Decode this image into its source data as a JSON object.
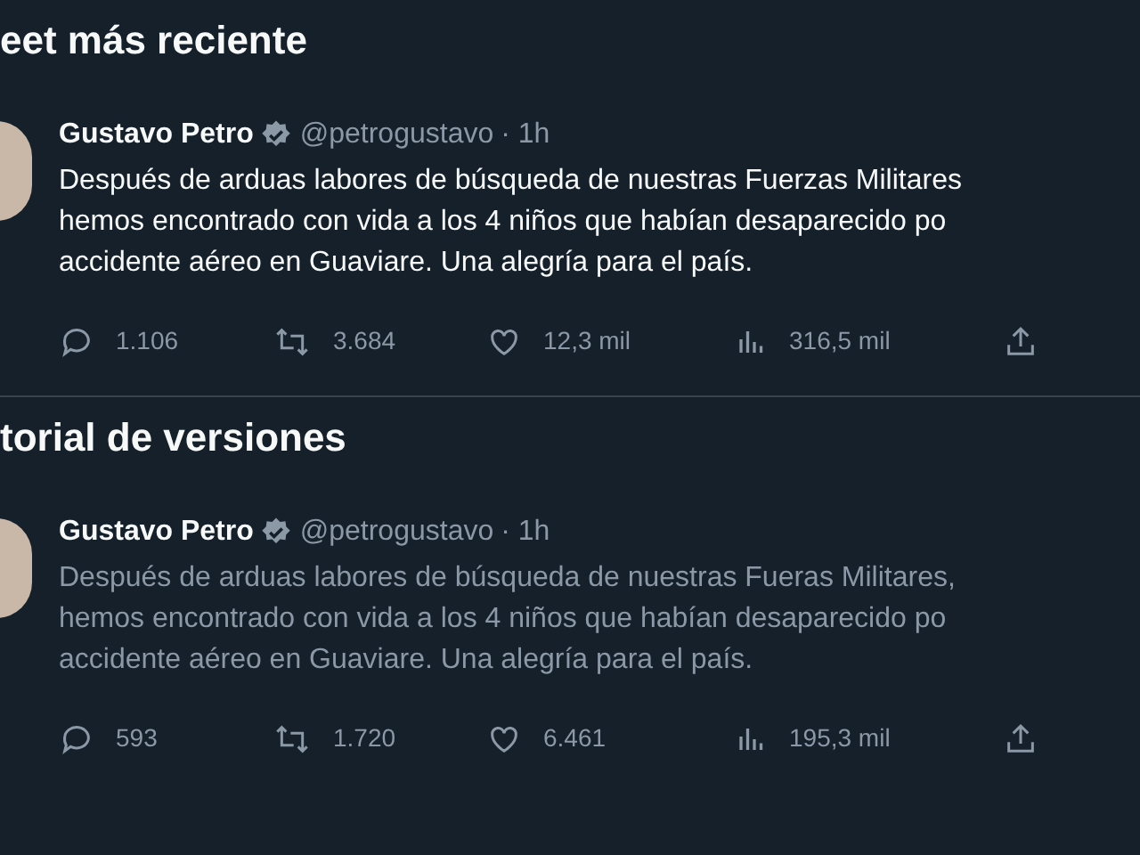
{
  "sections": [
    {
      "heading": "eet más reciente",
      "tweet": {
        "name": "Gustavo Petro",
        "handle": "@petrogustavo",
        "time": "· 1h",
        "faded": false,
        "lines": [
          "Después de arduas labores de búsqueda de nuestras Fuerzas Militares",
          "hemos encontrado con vida a los 4 niños que habían desaparecido po",
          "accidente aéreo en Guaviare. Una alegría para el país."
        ],
        "stats": [
          {
            "kind": "reply",
            "count": "1.106"
          },
          {
            "kind": "retweet",
            "count": "3.684"
          },
          {
            "kind": "like",
            "count": "12,3 mil"
          },
          {
            "kind": "views",
            "count": "316,5 mil"
          },
          {
            "kind": "share"
          }
        ]
      }
    },
    {
      "heading": "torial de versiones",
      "tweet": {
        "name": "Gustavo Petro",
        "handle": "@petrogustavo",
        "time": "· 1h",
        "faded": true,
        "lines": [
          "Después de arduas labores de búsqueda de nuestras Fueras Militares,",
          "hemos encontrado con vida a los 4 niños que habían desaparecido po",
          "accidente aéreo en Guaviare. Una alegría para el país."
        ],
        "stats": [
          {
            "kind": "reply",
            "count": "593"
          },
          {
            "kind": "retweet",
            "count": "1.720"
          },
          {
            "kind": "like",
            "count": "6.461"
          },
          {
            "kind": "views",
            "count": "195,3 mil"
          },
          {
            "kind": "share"
          }
        ]
      }
    }
  ]
}
